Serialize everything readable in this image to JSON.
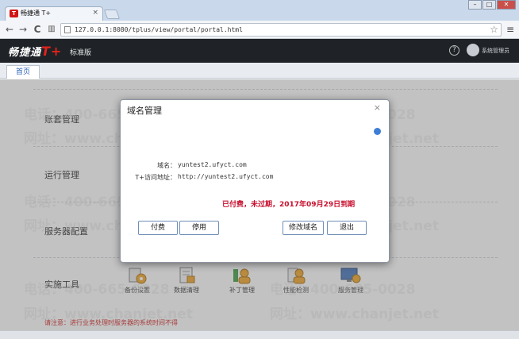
{
  "browser": {
    "tab_title": "畅捷通 T+",
    "url": "127.0.0.1:8080/tplus/view/portal/portal.html",
    "win_minimize": "–",
    "win_maximize": "□",
    "win_close": "✕",
    "back": "←",
    "forward": "→",
    "reload": "C",
    "tab_close": "×",
    "star": "☆",
    "menu": "≡"
  },
  "app": {
    "logo_text": "畅捷通",
    "logo_brand": "T+",
    "edition": "标准版",
    "help": "?",
    "user_name": "系统管理员",
    "home_tab": "首页"
  },
  "sections": {
    "account": "账套管理",
    "operation": "运行管理",
    "server_config": "服务器配置",
    "tools": "实施工具"
  },
  "tools": [
    {
      "label": "备份设置"
    },
    {
      "label": "数据清理"
    },
    {
      "label": "补丁管理"
    },
    {
      "label": "性能检测"
    },
    {
      "label": "服务管理"
    }
  ],
  "notice": "请注意：进行业务处理时服务器的系统时间不得",
  "watermarks": {
    "phone": "电话：400-665-0028",
    "site": "网址：www.chanjet.net"
  },
  "dialog": {
    "title": "域名管理",
    "close": "×",
    "domain_label": "域名：",
    "domain_value": "yuntest2.ufyct.com",
    "access_label": "T+访问地址：",
    "access_value": "http://yuntest2.ufyct.com",
    "paid_status": "已付费，未过期，2017年09月29日到期",
    "buttons": {
      "pay": "付费",
      "disable": "停用",
      "modify": "修改域名",
      "exit": "退出"
    }
  },
  "colors": {
    "header_bg": "#1f2327",
    "brand_red": "#e2231a",
    "status_red": "#c8102e",
    "link_blue": "#2b63b5"
  }
}
